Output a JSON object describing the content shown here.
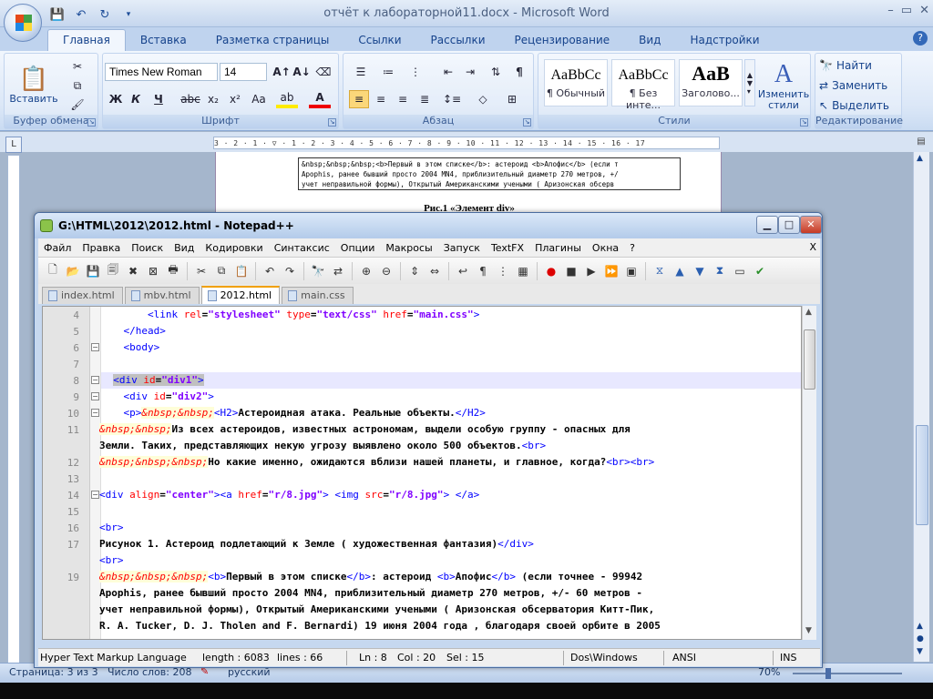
{
  "word": {
    "title": "отчёт к лабораторной11.docx - Microsoft Word",
    "tabs": [
      "Главная",
      "Вставка",
      "Разметка страницы",
      "Ссылки",
      "Рассылки",
      "Рецензирование",
      "Вид",
      "Надстройки"
    ],
    "help": "?",
    "clipboard": {
      "paste": "Вставить",
      "title": "Буфер обмена"
    },
    "font": {
      "name": "Times New Roman",
      "size": "14",
      "title": "Шрифт",
      "bold": "Ж",
      "italic": "К",
      "underline": "Ч",
      "strike": "abc",
      "sub": "x₂",
      "sup": "x²",
      "case": "Aa"
    },
    "paragraph": {
      "title": "Абзац"
    },
    "styles": {
      "title": "Стили",
      "items": [
        {
          "sample": "AaBbCc",
          "label": "¶ Обычный"
        },
        {
          "sample": "AaBbCc",
          "label": "¶ Без инте..."
        },
        {
          "sample": "AaB",
          "label": "Заголово..."
        }
      ],
      "change": "Изменить стили"
    },
    "editing": {
      "title": "Редактирование",
      "find": "Найти",
      "replace": "Заменить",
      "select": "Выделить"
    },
    "ruler": "3 · 2 · 1 · ▽ · 1 · 2 · 3 · 4 · 5 · 6 · 7 · 8 · 9 · 10 · 11 · 12 · 13 · 14 · 15 · 16 · 17",
    "doc": {
      "lines": [
        "&nbsp;&nbsp;&nbsp;<b>Первый в этом списке</b>: астероид <b>Апофис</b> (если т",
        "Apophis, ранее бывший просто 2004 MN4, приблизительный диаметр 270 метров, +/",
        "учет неправильной формы), Открытый Американскими учеными ( Аризонская обсерв"
      ],
      "caption": "Рис.1 «Элемент div»"
    },
    "status": {
      "page": "Страница: 3 из 3",
      "words": "Число слов: 208",
      "lang": "русский",
      "zoom": "70%"
    }
  },
  "npp": {
    "title": "G:\\HTML\\2012\\2012.html - Notepad++",
    "menu": [
      "Файл",
      "Правка",
      "Поиск",
      "Вид",
      "Кодировки",
      "Синтаксис",
      "Опции",
      "Макросы",
      "Запуск",
      "TextFX",
      "Плагины",
      "Окна",
      "?"
    ],
    "menu_close": "X",
    "tabs": [
      {
        "label": "index.html",
        "active": false
      },
      {
        "label": "mbv.html",
        "active": false
      },
      {
        "label": "2012.html",
        "active": true
      },
      {
        "label": "main.css",
        "active": false
      }
    ],
    "line_numbers": [
      "4",
      "5",
      "6",
      "7",
      "8",
      "9",
      "10",
      "11",
      "",
      "12",
      "13",
      "14",
      "15",
      "16",
      "17",
      "",
      "19",
      "",
      "",
      ""
    ],
    "code": {
      "l4a": "<link ",
      "l4b": "rel",
      "l4c": "=",
      "l4d": "\"stylesheet\"",
      "l4e": " type",
      "l4f": "=",
      "l4g": "\"text/css\"",
      "l4h": " href",
      "l4i": "=",
      "l4j": "\"main.css\"",
      "l4k": ">",
      "l5": "</head>",
      "l6": "<body>",
      "l8a": "<div",
      "l8b": " id",
      "l8c": "=",
      "l8d": "\"div1\"",
      "l8e": ">",
      "l9a": "<div",
      "l9b": " id",
      "l9c": "=",
      "l9d": "\"div2\"",
      "l9e": ">",
      "l10a": "<p>",
      "l10b": "&nbsp;&nbsp;",
      "l10c": "<H2>",
      "l10d": "Астероидная атака. Реальные объекты.",
      "l10e": "</H2>",
      "l11a": "&nbsp;&nbsp;",
      "l11b": "Из всех астероидов, известных астрономам, выдели особую группу - опасных для",
      "l11c": "Земли. Таких, представляющих некую угрозу выявлено около 500 объектов.",
      "l11d": "<br>",
      "l12a": "&nbsp;&nbsp;&nbsp;",
      "l12b": "Но какие именно, ожидаются вблизи нашей планеты, и главное, когда?",
      "l12c": "<br><br>",
      "l14a": "<div ",
      "l14b": "align",
      "l14c": "=",
      "l14d": "\"center\"",
      "l14e": "><a ",
      "l14f": "href",
      "l14g": "=",
      "l14h": "\"r/8.jpg\"",
      "l14i": "> <img ",
      "l14j": "src",
      "l14k": "=",
      "l14l": "\"r/8.jpg\"",
      "l14m": "> </a>",
      "l16": "<br>",
      "l17a": "Рисунок 1. Астероид подлетающий к Земле ( художественная фантазия)",
      "l17b": "</div>",
      "l18": "<br>",
      "l19a": "&nbsp;&nbsp;&nbsp;",
      "l19b": "<b>",
      "l19c": "Первый в этом списке",
      "l19d": "</b>",
      "l19e": ": астероид ",
      "l19f": "<b>",
      "l19g": "Апофис",
      "l19h": "</b>",
      "l19i": " (если точнее - 99942",
      "l19j": "Apophis, ранее бывший просто 2004 MN4, приблизительный диаметр 270 метров, +/- 60 метров -",
      "l19k": "учет неправильной формы), Открытый Американскими учеными ( Аризонская обсерватория Китт-Пик,",
      "l19l": "R. A. Tucker, D. J. Tholen and F. Bernardi) 19 июня 2004 года , благодаря своей орбите в 2005"
    },
    "status": {
      "lang": "Hyper Text Markup Language",
      "length": "length : 6083",
      "lines": "lines : 66",
      "ln": "Ln : 8",
      "col": "Col : 20",
      "sel": "Sel : 15",
      "eol": "Dos\\Windows",
      "enc": "ANSI",
      "mode": "INS"
    }
  },
  "colors": {
    "tag": "#0000ff",
    "attr": "#ff0000",
    "value": "#8000ff",
    "entity": "#ff0000",
    "current_line": "#e8e8ff"
  }
}
